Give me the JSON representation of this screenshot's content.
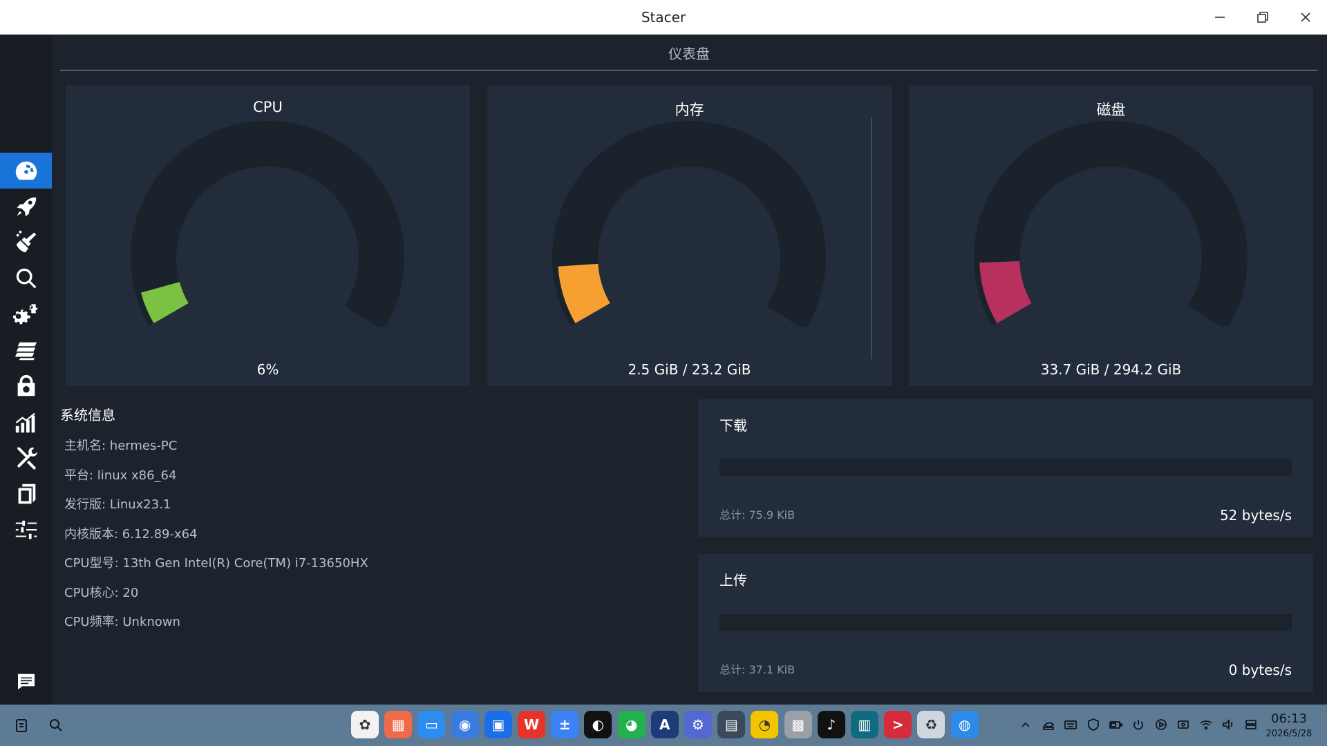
{
  "window": {
    "title": "Stacer",
    "controls": {
      "minimize": "minimize-icon",
      "restore": "restore-icon",
      "close": "close-icon"
    }
  },
  "sidebar": {
    "items": [
      {
        "icon": "dashboard-icon",
        "active": true
      },
      {
        "icon": "startup-rocket-icon",
        "active": false
      },
      {
        "icon": "cleaner-broom-icon",
        "active": false
      },
      {
        "icon": "search-icon",
        "active": false
      },
      {
        "icon": "services-gears-icon",
        "active": false
      },
      {
        "icon": "processes-icon",
        "active": false
      },
      {
        "icon": "uninstaller-icon",
        "active": false
      },
      {
        "icon": "resources-chart-icon",
        "active": false
      },
      {
        "icon": "helpers-tools-icon",
        "active": false
      },
      {
        "icon": "apt-repository-icon",
        "active": false
      },
      {
        "icon": "settings-sliders-icon",
        "active": false
      }
    ],
    "feedback_icon": "feedback-chat-icon"
  },
  "dashboard": {
    "title": "仪表盘",
    "gauges": [
      {
        "id": "cpu",
        "title": "CPU",
        "value_text": "6%",
        "percent": 6,
        "color": "#7cc242"
      },
      {
        "id": "memory",
        "title": "内存",
        "value_text": "2.5 GiB / 23.2 GiB",
        "percent": 10.8,
        "color": "#f5a030"
      },
      {
        "id": "disk",
        "title": "磁盘",
        "value_text": "33.7 GiB / 294.2 GiB",
        "percent": 11.5,
        "color": "#b8305d"
      }
    ],
    "track_color": "#1a222c"
  },
  "system_info": {
    "heading": "系统信息",
    "rows": [
      "主机名: hermes-PC",
      "平台: linux x86_64",
      "发行版: Linux23.1",
      "内核版本: 6.12.89-x64",
      "CPU型号:  13th Gen Intel(R) Core(TM) i7-13650HX",
      "CPU核心: 20",
      "CPU频率: Unknown"
    ]
  },
  "network": {
    "download": {
      "title": "下载",
      "total": "总计: 75.9 KiB",
      "rate": "52 bytes/s"
    },
    "upload": {
      "title": "上传",
      "total": "总计: 37.1 KiB",
      "rate": "0 bytes/s"
    }
  },
  "taskbar": {
    "left_icons": [
      "clipboard-icon",
      "search-icon"
    ],
    "apps": [
      {
        "name": "launcher-icon",
        "color": "#f2f2f2",
        "glyph": "✿"
      },
      {
        "name": "multitask-icon",
        "color": "#f06a4a",
        "glyph": "▦"
      },
      {
        "name": "file-manager-icon",
        "color": "#2d8cf0",
        "glyph": "▭"
      },
      {
        "name": "browser-icon",
        "color": "#3a7be0",
        "glyph": "◉"
      },
      {
        "name": "app-store-icon",
        "color": "#1c6ee8",
        "glyph": "▣"
      },
      {
        "name": "wps-icon",
        "color": "#e8332a",
        "glyph": "W"
      },
      {
        "name": "calculator-icon",
        "color": "#3b82f6",
        "glyph": "±"
      },
      {
        "name": "linux-qq-icon",
        "color": "#111111",
        "glyph": "◐"
      },
      {
        "name": "wechat-icon",
        "color": "#22b14c",
        "glyph": "◕"
      },
      {
        "name": "typora-icon",
        "color": "#1d3d7a",
        "glyph": "A"
      },
      {
        "name": "control-center-icon",
        "color": "#5468d4",
        "glyph": "⚙"
      },
      {
        "name": "printer-icon",
        "color": "#3a4a5a",
        "glyph": "▤"
      },
      {
        "name": "media-player-icon",
        "color": "#f2c500",
        "glyph": "◔"
      },
      {
        "name": "screenshot-icon",
        "color": "#9aa0a6",
        "glyph": "▩"
      },
      {
        "name": "tiktok-icon",
        "color": "#111111",
        "glyph": "♪"
      },
      {
        "name": "editor-icon",
        "color": "#0f6c80",
        "glyph": "▥"
      },
      {
        "name": "terminal-icon",
        "color": "#d62b3a",
        "glyph": ">"
      },
      {
        "name": "recycle-bin-icon",
        "color": "#cfd6dd",
        "glyph": "♻"
      },
      {
        "name": "stacer-icon",
        "color": "#2c8be8",
        "glyph": "◍"
      }
    ],
    "tray_icons": [
      "chevron-up-icon",
      "nvidia-icon",
      "keyboard-icon",
      "vpn-icon",
      "battery-icon",
      "power-icon",
      "play-icon",
      "screen-icon",
      "wifi-icon",
      "volume-icon",
      "dock-toggle-icon"
    ],
    "clock": {
      "time": "06:13",
      "date": "2026/5/28"
    }
  }
}
